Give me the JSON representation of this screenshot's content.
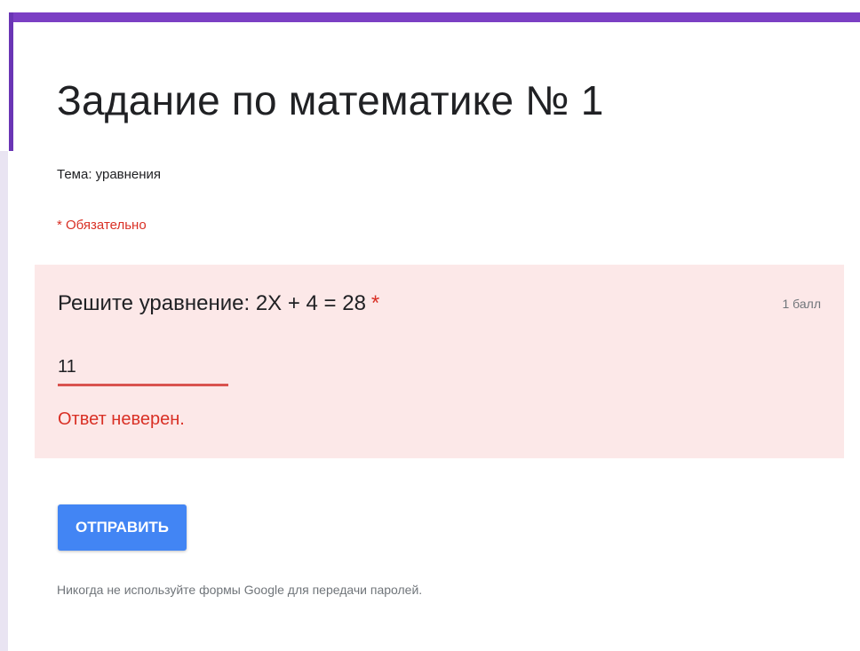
{
  "form": {
    "title": "Задание по математике № 1",
    "description": "Тема: уравнения",
    "required_note": "* Обязательно"
  },
  "question": {
    "title": "Решите уравнение: 2X + 4 = 28",
    "required_marker": "*",
    "points": "1 балл",
    "answer_value": "11",
    "feedback": "Ответ неверен."
  },
  "actions": {
    "submit_label": "ОТПРАВИТЬ"
  },
  "footer": {
    "note": "Никогда не используйте формы Google для передачи паролей."
  },
  "colors": {
    "accent": "#7b3fc4",
    "error": "#d93025",
    "card_error_bg": "#fce8e8",
    "submit_bg": "#4285f4"
  }
}
